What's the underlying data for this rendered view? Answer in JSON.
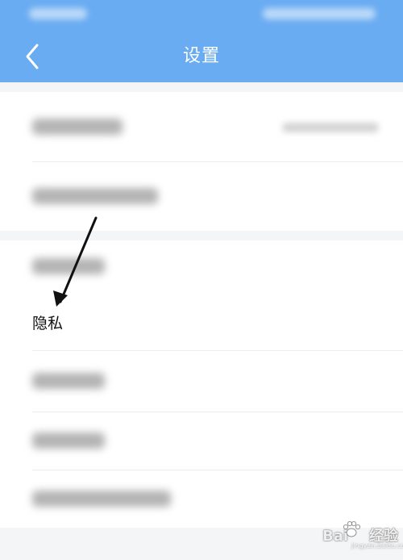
{
  "header": {
    "title": "设置",
    "back_icon": "chevron-left-icon"
  },
  "settings": {
    "privacy_label": "隐私"
  },
  "watermark": {
    "brand": "Bai",
    "brand_suffix": "经验",
    "sub": "jingyan.baidu.com"
  },
  "colors": {
    "header_bg": "#6aacf2",
    "background": "#f4f5f7",
    "row_bg": "#ffffff",
    "annotation_arrow": "#111111"
  }
}
